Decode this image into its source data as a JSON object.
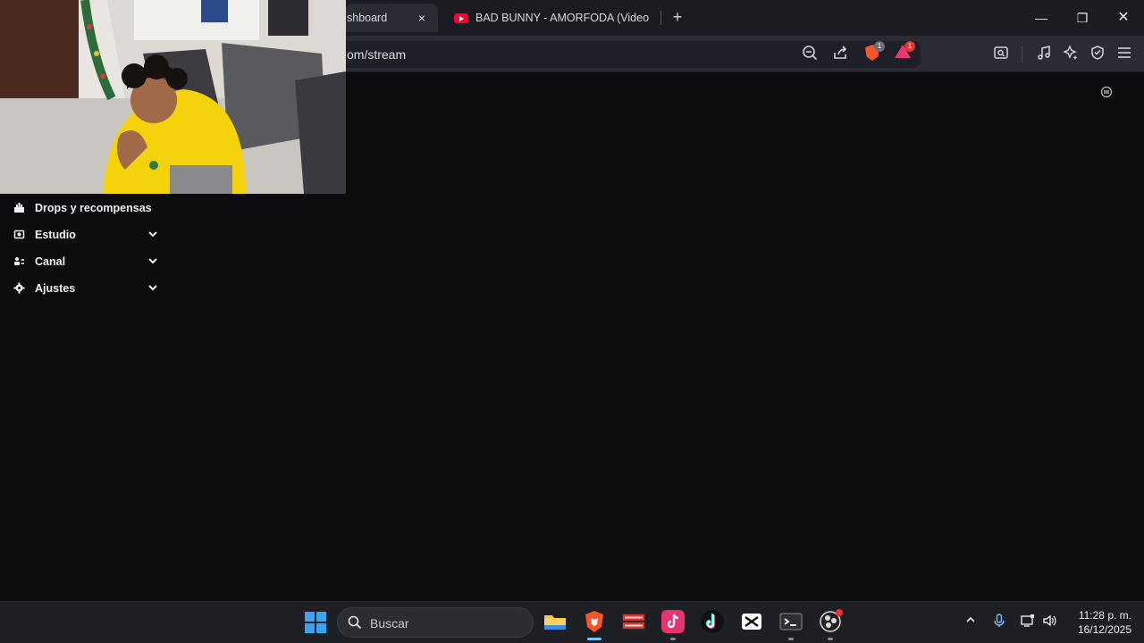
{
  "browser": {
    "tabs": [
      {
        "title": "shboard",
        "close": "×"
      },
      {
        "title": "BAD BUNNY - AMORFODA (Video Of",
        "icon": "youtube-icon"
      }
    ],
    "new_tab": "+",
    "url": "om/stream",
    "badges": {
      "shields": "1",
      "rewards": "1"
    },
    "window": {
      "minimize": "—",
      "maximize": "❐",
      "close": "✕"
    }
  },
  "sidebar": {
    "items": [
      {
        "label": "Drops y recompensas",
        "icon": "gift-icon"
      },
      {
        "label": "Estudio",
        "icon": "studio-icon",
        "expandable": true
      },
      {
        "label": "Canal",
        "icon": "channel-icon",
        "expandable": true
      },
      {
        "label": "Ajustes",
        "icon": "gear-icon",
        "expandable": true
      }
    ]
  },
  "taskbar": {
    "search_placeholder": "Buscar",
    "time": "11:28 p. m.",
    "date": "16/12/2025"
  },
  "colors": {
    "background": "#0c0c0e",
    "chrome": "#2a2b33",
    "brave": "#fb542b",
    "youtube": "#ff0033",
    "taskbar": "#1e1f24"
  }
}
